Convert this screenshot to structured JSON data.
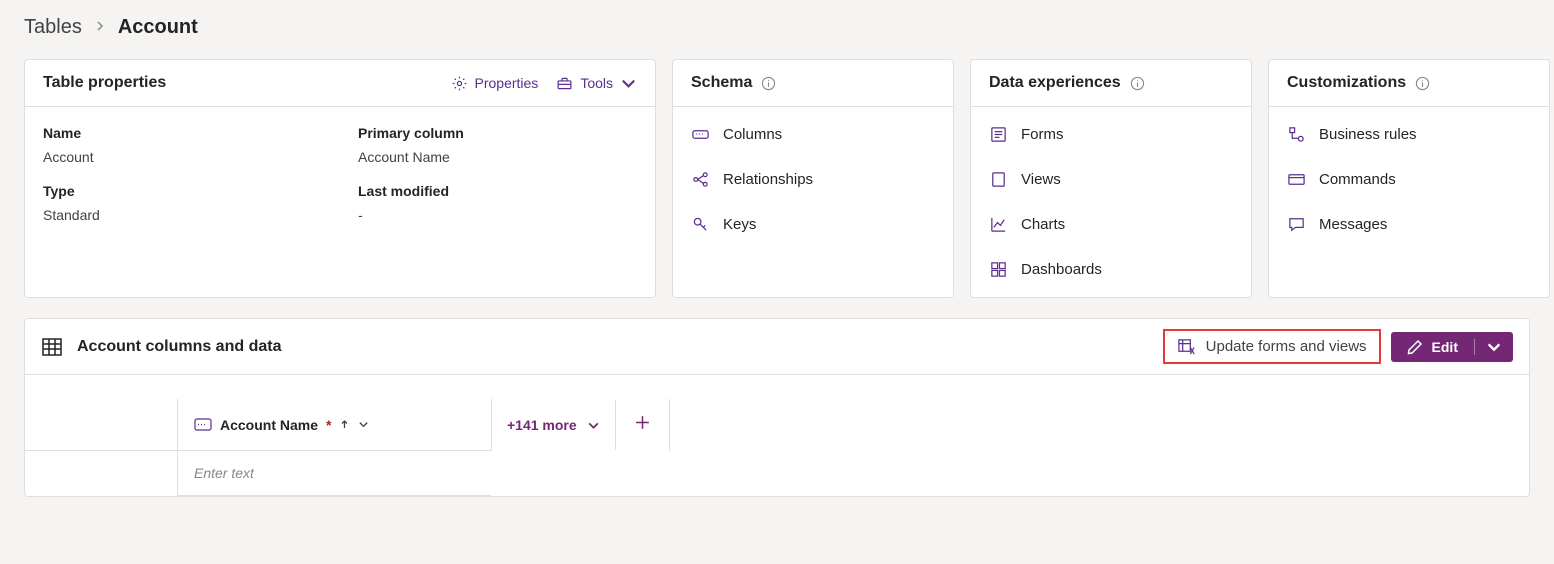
{
  "breadcrumb": {
    "parent": "Tables",
    "current": "Account"
  },
  "properties_card": {
    "title": "Table properties",
    "actions": {
      "properties": "Properties",
      "tools": "Tools"
    },
    "rows": {
      "name_label": "Name",
      "name_value": "Account",
      "primary_label": "Primary column",
      "primary_value": "Account Name",
      "type_label": "Type",
      "type_value": "Standard",
      "modified_label": "Last modified",
      "modified_value": "-"
    }
  },
  "schema_card": {
    "title": "Schema",
    "items": {
      "columns": "Columns",
      "relationships": "Relationships",
      "keys": "Keys"
    }
  },
  "data_exp_card": {
    "title": "Data experiences",
    "items": {
      "forms": "Forms",
      "views": "Views",
      "charts": "Charts",
      "dashboards": "Dashboards"
    }
  },
  "custom_card": {
    "title": "Customizations",
    "items": {
      "rules": "Business rules",
      "commands": "Commands",
      "messages": "Messages"
    }
  },
  "data_section": {
    "title": "Account columns and data",
    "update_label": "Update forms and views",
    "edit_label": "Edit",
    "column_header": "Account Name",
    "more_label": "+141 more",
    "placeholder": "Enter text"
  }
}
